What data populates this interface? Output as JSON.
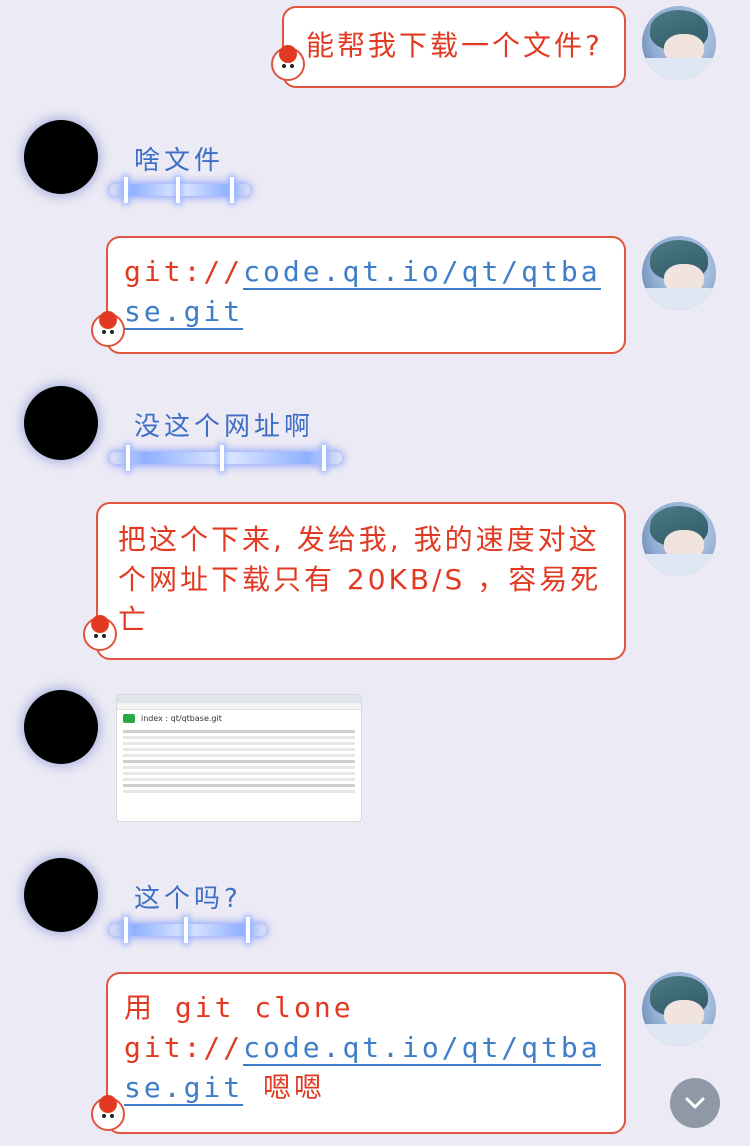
{
  "messages": [
    {
      "side": "right",
      "text": "能帮我下载一个文件?"
    },
    {
      "side": "left",
      "text": "啥文件"
    },
    {
      "side": "right",
      "prefix": "git://",
      "link": "code.qt.io/qt/qtbase.git"
    },
    {
      "side": "left",
      "text": "没这个网址啊"
    },
    {
      "side": "right",
      "line1": "把这个下来, 发给我, 我的速度对这",
      "line2": "个网址下载只有 20KB/S ，容易死",
      "line3": "亡"
    },
    {
      "side": "left",
      "image_title": "index : qt/qtbase.git"
    },
    {
      "side": "left",
      "text": "这个吗?"
    },
    {
      "side": "right",
      "line1": "用 git clone",
      "prefix": "git://",
      "link": "code.qt.io/qt/qtbase.git",
      "suffix": " 嗯嗯"
    }
  ],
  "colors": {
    "right_text": "#e23a22",
    "left_text": "#3e6fc4",
    "link": "#3e7dc8",
    "bubble_border": "#e0543f"
  },
  "icons": {
    "scroll_down": "chevron-down-icon"
  }
}
